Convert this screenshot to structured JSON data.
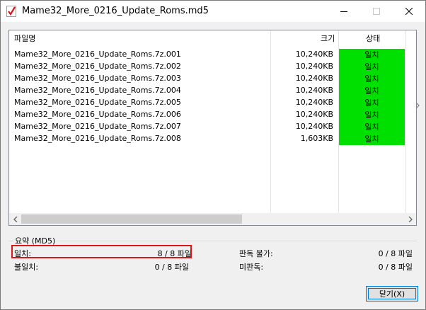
{
  "window": {
    "title": "Mame32_More_0216_Update_Roms.md5"
  },
  "list": {
    "columns": {
      "name": "파일명",
      "size": "크기",
      "status": "상태"
    },
    "rows": [
      {
        "name": "Mame32_More_0216_Update_Roms.7z.001",
        "size": "10,240KB",
        "status": "일치"
      },
      {
        "name": "Mame32_More_0216_Update_Roms.7z.002",
        "size": "10,240KB",
        "status": "일치"
      },
      {
        "name": "Mame32_More_0216_Update_Roms.7z.003",
        "size": "10,240KB",
        "status": "일치"
      },
      {
        "name": "Mame32_More_0216_Update_Roms.7z.004",
        "size": "10,240KB",
        "status": "일치"
      },
      {
        "name": "Mame32_More_0216_Update_Roms.7z.005",
        "size": "10,240KB",
        "status": "일치"
      },
      {
        "name": "Mame32_More_0216_Update_Roms.7z.006",
        "size": "10,240KB",
        "status": "일치"
      },
      {
        "name": "Mame32_More_0216_Update_Roms.7z.007",
        "size": "10,240KB",
        "status": "일치"
      },
      {
        "name": "Mame32_More_0216_Update_Roms.7z.008",
        "size": "1,603KB",
        "status": "일치"
      }
    ],
    "status_color": "#00e000"
  },
  "summary": {
    "label": "요약 (MD5)",
    "match_label": "일치:",
    "match_value": "8 / 8 파일",
    "mismatch_label": "불일치:",
    "mismatch_value": "0 / 8 파일",
    "unknown_label": "판독 불가:",
    "unknown_value": "0 / 8 파일",
    "unread_label": "미판독:",
    "unread_value": "0 / 8 파일",
    "highlight_color": "#e0151b"
  },
  "buttons": {
    "close_label": "닫기(X)"
  }
}
